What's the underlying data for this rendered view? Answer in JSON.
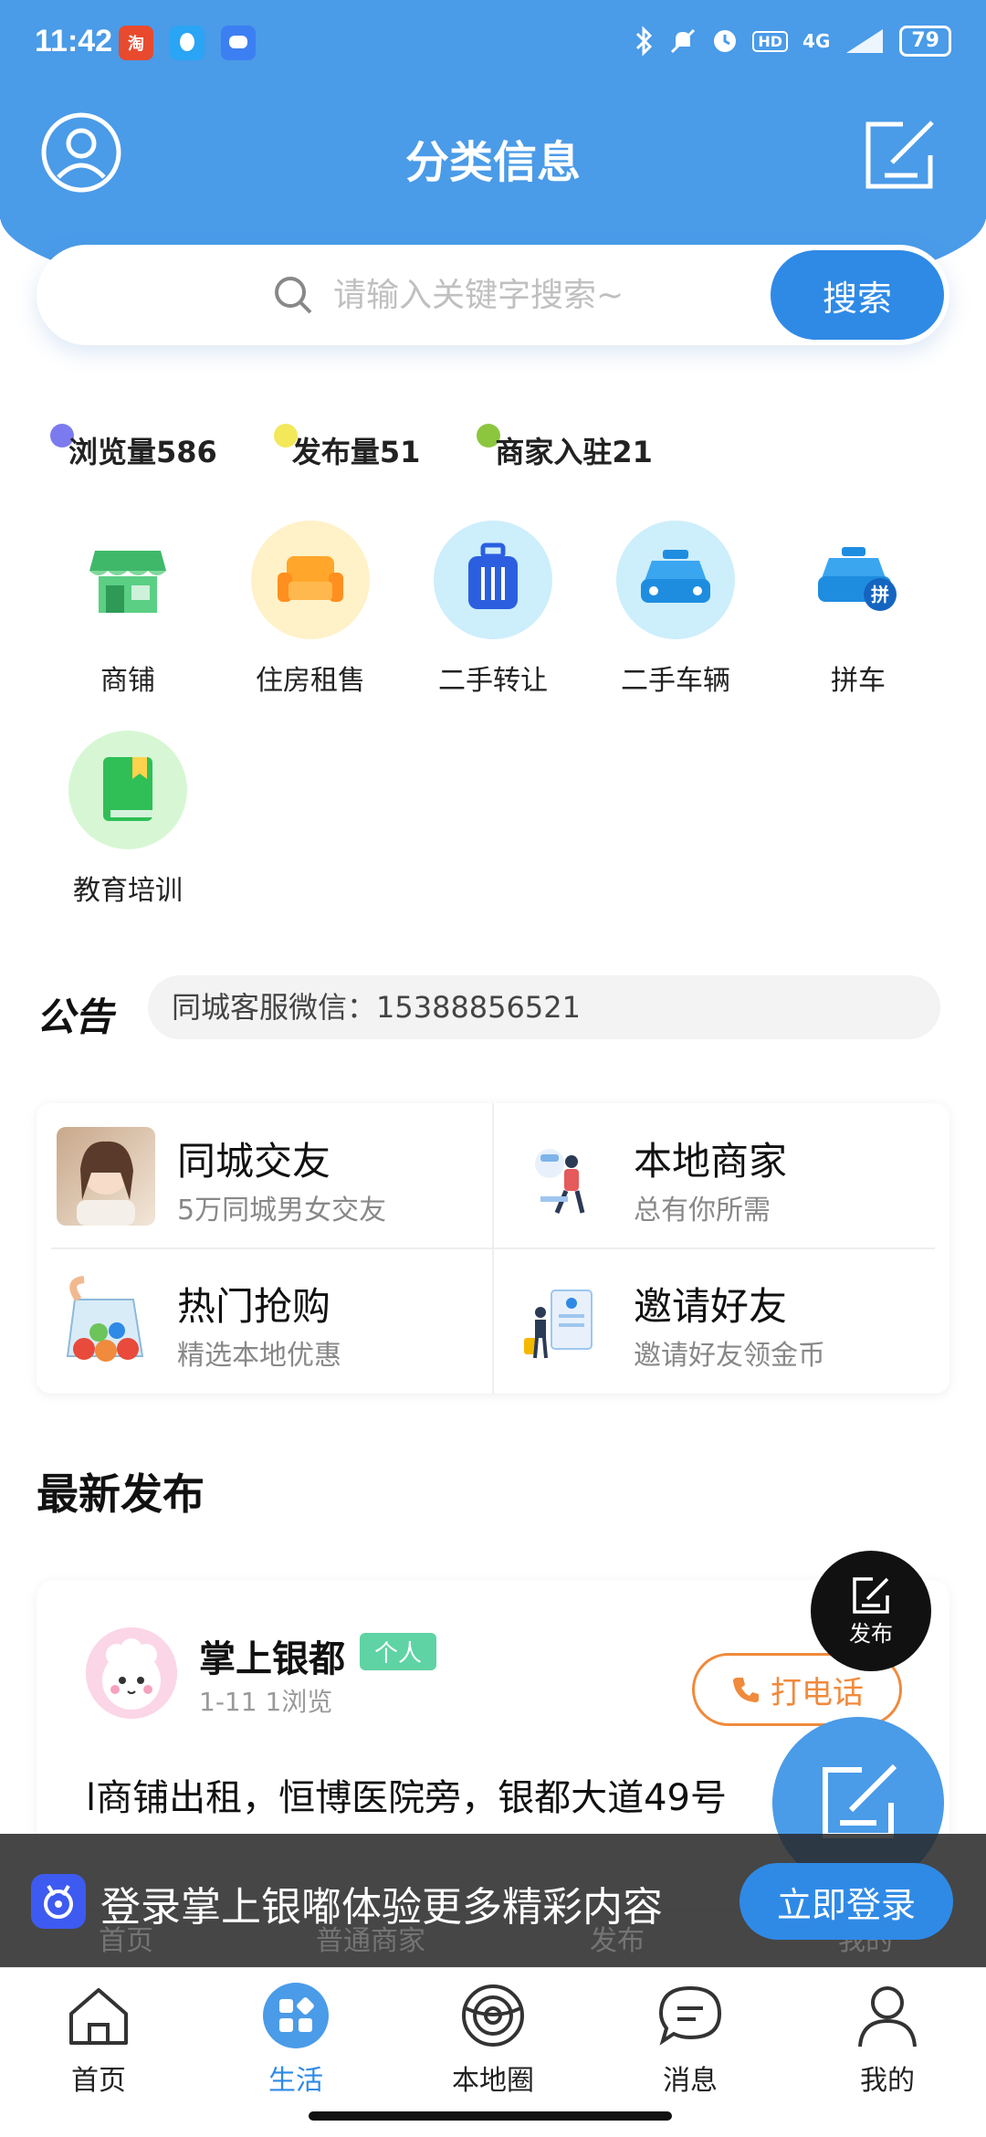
{
  "status_bar": {
    "time": "11:42",
    "network": "4G",
    "battery": "79",
    "hd": "HD"
  },
  "header": {
    "title": "分类信息"
  },
  "search": {
    "placeholder": "请输入关键字搜索~",
    "button_label": "搜索"
  },
  "stats": [
    {
      "label": "浏览量586",
      "dot_color": "#7b7bef"
    },
    {
      "label": "发布量51",
      "dot_color": "#f3e85a"
    },
    {
      "label": "商家入驻21",
      "dot_color": "#8cc63f"
    }
  ],
  "categories": [
    {
      "label": "商铺",
      "icon": "shop-icon"
    },
    {
      "label": "住房租售",
      "icon": "sofa-icon"
    },
    {
      "label": "二手转让",
      "icon": "suitcase-icon"
    },
    {
      "label": "二手车辆",
      "icon": "car-icon"
    },
    {
      "label": "拼车",
      "icon": "carpool-icon"
    },
    {
      "label": "教育培训",
      "icon": "book-icon"
    }
  ],
  "notice": {
    "logo": "公告",
    "text": "同城客服微信：15388856521"
  },
  "features": [
    {
      "title": "同城交友",
      "subtitle": "5万同城男女交友"
    },
    {
      "title": "本地商家",
      "subtitle": "总有你所需"
    },
    {
      "title": "热门抢购",
      "subtitle": "精选本地优惠"
    },
    {
      "title": "邀请好友",
      "subtitle": "邀请好友领金币"
    }
  ],
  "latest": {
    "title": "最新发布"
  },
  "post": {
    "name": "掌上银都",
    "tag": "个人",
    "meta": "1-11   1浏览",
    "call_label": "打电话",
    "text": "l商铺出租，恒博医院旁，银都大道49号"
  },
  "fab": {
    "publish_label": "发布"
  },
  "login_banner": {
    "text": "登录掌上银嘟体验更多精彩内容",
    "button_label": "立即登录",
    "ghost_tabs": [
      "首页",
      "普通商家",
      "发布",
      "我的"
    ]
  },
  "bottom_nav": [
    {
      "label": "首页",
      "icon": "home-icon"
    },
    {
      "label": "生活",
      "icon": "life-icon",
      "active": true
    },
    {
      "label": "本地圈",
      "icon": "local-circle-icon"
    },
    {
      "label": "消息",
      "icon": "message-icon"
    },
    {
      "label": "我的",
      "icon": "profile-icon"
    }
  ],
  "colors": {
    "primary": "#4a9be8",
    "button": "#2f8ae6",
    "call": "#f08a3c",
    "tag": "#5fd3a4"
  }
}
